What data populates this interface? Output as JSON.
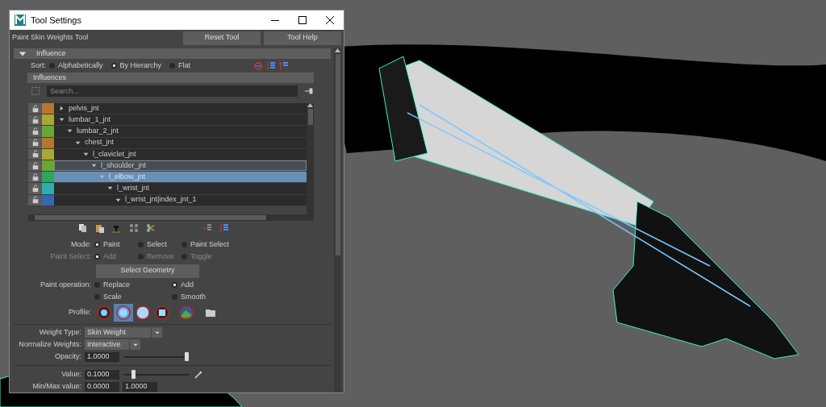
{
  "window": {
    "title": "Tool Settings"
  },
  "tool": {
    "name": "Paint Skin Weights Tool",
    "buttons": [
      "Reset Tool",
      "Tool Help"
    ]
  },
  "influence_section": {
    "title": "Influence",
    "expanded": true,
    "sort": {
      "label": "Sort:",
      "options": [
        {
          "label": "Alphabetically",
          "selected": false
        },
        {
          "label": "By Hierarchy",
          "selected": true
        },
        {
          "label": "Flat",
          "selected": false
        }
      ]
    },
    "influences_header": "Influences",
    "search": {
      "placeholder": "Search..."
    },
    "tree": [
      {
        "name": "pelvis_jnt",
        "color": "#b5762f",
        "expanded": false,
        "selected": false,
        "hovered": false
      },
      {
        "name": "lumbar_1_jnt",
        "color": "#a9a834",
        "expanded": true,
        "selected": false,
        "hovered": false,
        "children": [
          {
            "name": "lumbar_2_jnt",
            "color": "#6aa732",
            "expanded": true,
            "selected": false,
            "hovered": false,
            "children": [
              {
                "name": "chest_jnt",
                "color": "#b5762f",
                "expanded": true,
                "selected": false,
                "hovered": false,
                "children": [
                  {
                    "name": "l_claviclet_jnt",
                    "color": "#a9a834",
                    "expanded": true,
                    "selected": false,
                    "hovered": false,
                    "children": [
                      {
                        "name": "l_shoulder_jnt",
                        "color": "#6aa732",
                        "expanded": true,
                        "selected": false,
                        "hovered": true,
                        "children": [
                          {
                            "name": "l_elbow_jnt",
                            "color": "#2fa65f",
                            "expanded": true,
                            "selected": true,
                            "hovered": false,
                            "children": [
                              {
                                "name": "l_wrist_jnt",
                                "color": "#2fadad",
                                "expanded": true,
                                "selected": false,
                                "hovered": false,
                                "children": [
                                  {
                                    "name": "l_wrist_jnt|index_jnt_1",
                                    "color": "#3469ae",
                                    "expanded": true,
                                    "selected": false,
                                    "hovered": false
                                  }
                                ]
                              }
                            ]
                          }
                        ]
                      }
                    ]
                  }
                ]
              }
            ]
          }
        ]
      }
    ]
  },
  "mode": {
    "label": "Mode:",
    "options": [
      {
        "label": "Paint",
        "selected": true
      },
      {
        "label": "Select",
        "selected": false
      },
      {
        "label": "Paint Select",
        "selected": false
      }
    ]
  },
  "paint_select": {
    "label": "Paint Select:",
    "disabled": true,
    "options": [
      {
        "label": "Add",
        "selected": true
      },
      {
        "label": "Remove",
        "selected": false
      },
      {
        "label": "Toggle",
        "selected": false
      }
    ]
  },
  "select_geometry_button": "Select Geometry",
  "paint_operation": {
    "label": "Paint operation:",
    "options": [
      {
        "label": "Replace",
        "selected": false
      },
      {
        "label": "Add",
        "selected": true
      },
      {
        "label": "Scale",
        "selected": false
      },
      {
        "label": "Smooth",
        "selected": false
      }
    ]
  },
  "profile": {
    "label": "Profile:",
    "brushes": [
      {
        "kind": "gaussian",
        "selected": false
      },
      {
        "kind": "soft",
        "selected": true
      },
      {
        "kind": "solid",
        "selected": false
      },
      {
        "kind": "square",
        "selected": false
      },
      {
        "kind": "image",
        "selected": false
      },
      {
        "kind": "folder",
        "selected": false
      }
    ]
  },
  "weight_type": {
    "label": "Weight Type:",
    "value": "Skin Weight"
  },
  "normalize_weights": {
    "label": "Normalize Weights:",
    "value": "Interactive"
  },
  "opacity": {
    "label": "Opacity:",
    "value": "1.0000",
    "level": 1.0
  },
  "value": {
    "label": "Value:",
    "value": "0.1000",
    "level": 0.12
  },
  "min_max": {
    "label": "Min/Max value:",
    "min": "0.0000",
    "max": "1.0000"
  }
}
